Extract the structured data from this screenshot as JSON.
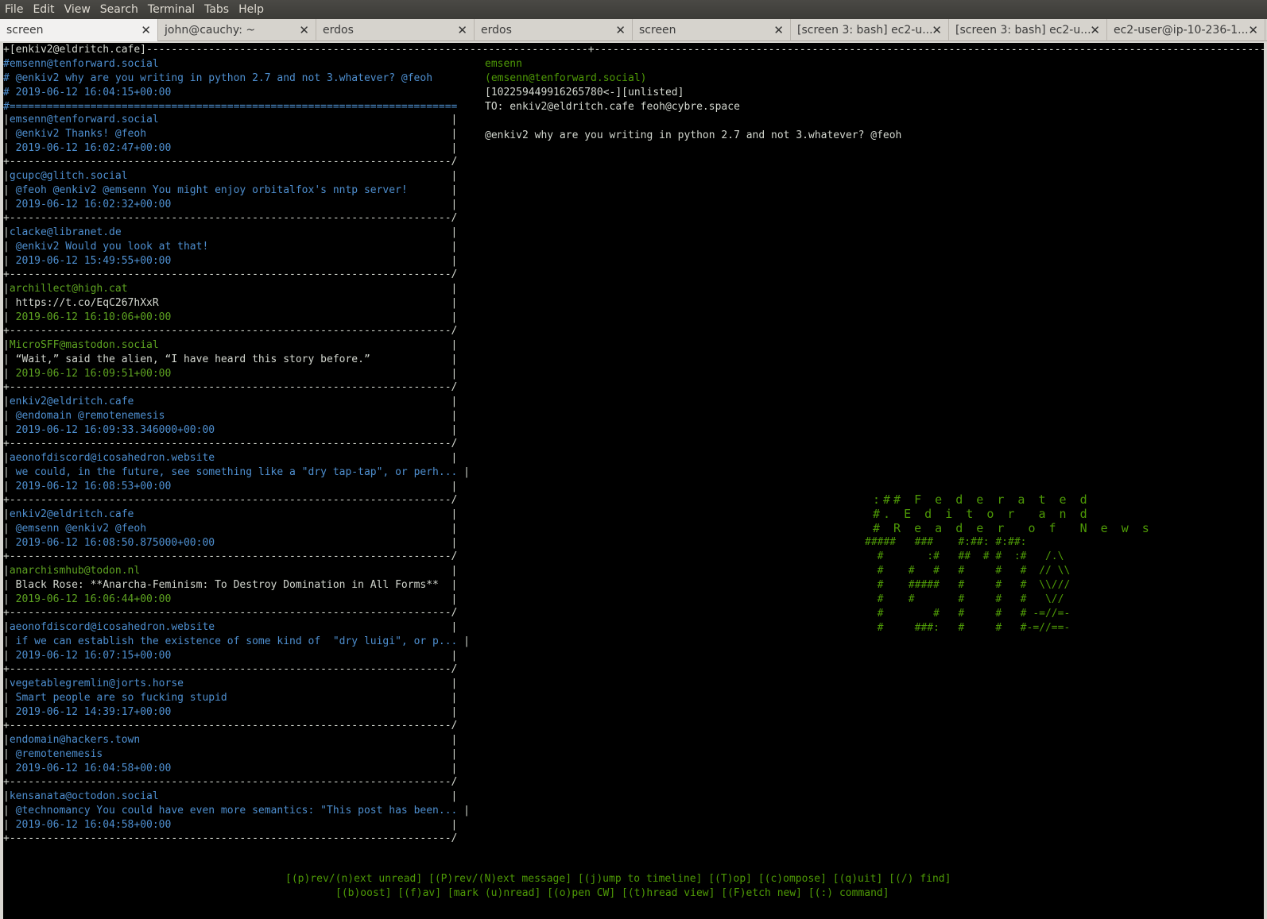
{
  "menubar": [
    "File",
    "Edit",
    "View",
    "Search",
    "Terminal",
    "Tabs",
    "Help"
  ],
  "tabs": [
    {
      "label": "screen",
      "active": true
    },
    {
      "label": "john@cauchy: ~",
      "active": false
    },
    {
      "label": "erdos",
      "active": false
    },
    {
      "label": "erdos",
      "active": false
    },
    {
      "label": "screen",
      "active": false
    },
    {
      "label": "[screen 3: bash] ec2-u...",
      "active": false
    },
    {
      "label": "[screen 3: bash] ec2-u...",
      "active": false
    },
    {
      "label": "ec2-user@ip-10-236-1...",
      "active": false
    }
  ],
  "close_glyph": "✕",
  "top_border": "+[enkiv2@eldritch.cafe]-----------------------------------------------------------------------+--------------------------------------------------------------------------------------------------------------------------",
  "selected": {
    "author": "#emsenn@tenforward.social",
    "body": "# @enkiv2 why are you writing in python 2.7 and not 3.whatever? @feoh",
    "date": "# 2019-06-12 16:04:15+00:00",
    "divider": "#========================================================================"
  },
  "posts": [
    {
      "author": "emsenn@tenforward.social",
      "body": "@enkiv2 Thanks! @feoh",
      "date": "2019-06-12 16:02:47+00:00",
      "author_color": "c",
      "body_color": "c",
      "date_color": "c"
    },
    {
      "author": "gcupc@glitch.social",
      "body": "@feoh @enkiv2 @emsenn You might enjoy orbitalfox's nntp server!",
      "date": "2019-06-12 16:02:32+00:00",
      "author_color": "c",
      "body_color": "c",
      "date_color": "c"
    },
    {
      "author": "clacke@libranet.de",
      "body": "@enkiv2 Would you look at that!",
      "date": "2019-06-12 15:49:55+00:00",
      "author_color": "c",
      "body_color": "c",
      "date_color": "c"
    },
    {
      "author": "archillect@high.cat",
      "body": "https://t.co/EqC267hXxR",
      "date": "2019-06-12 16:10:06+00:00",
      "author_color": "g",
      "body_color": "w",
      "date_color": "g"
    },
    {
      "author": "MicroSFF@mastodon.social",
      "body": "“Wait,” said the alien, “I have heard this story before.”",
      "date": "2019-06-12 16:09:51+00:00",
      "author_color": "g",
      "body_color": "w",
      "date_color": "g"
    },
    {
      "author": "enkiv2@eldritch.cafe",
      "body": "@endomain @remotenemesis",
      "date": "2019-06-12 16:09:33.346000+00:00",
      "author_color": "c",
      "body_color": "c",
      "date_color": "c"
    },
    {
      "author": "aeonofdiscord@icosahedron.website",
      "body": "we could, in the future, see something like a \"dry tap-tap\", or perh...",
      "date": "2019-06-12 16:08:53+00:00",
      "author_color": "c",
      "body_color": "c",
      "date_color": "c"
    },
    {
      "author": "enkiv2@eldritch.cafe",
      "body": "@emsenn @enkiv2 @feoh",
      "date": "2019-06-12 16:08:50.875000+00:00",
      "author_color": "c",
      "body_color": "c",
      "date_color": "c"
    },
    {
      "author": "anarchismhub@todon.nl",
      "body": "Black Rose: **Anarcha-Feminism: To Destroy Domination in All Forms**",
      "date": "2019-06-12 16:06:44+00:00",
      "author_color": "g",
      "body_color": "w",
      "date_color": "g"
    },
    {
      "author": "aeonofdiscord@icosahedron.website",
      "body": "if we can establish the existence of some kind of  \"dry luigi\", or p...",
      "date": "2019-06-12 16:07:15+00:00",
      "author_color": "c",
      "body_color": "c",
      "date_color": "c"
    },
    {
      "author": "vegetablegremlin@jorts.horse",
      "body": "Smart people are so fucking stupid",
      "date": "2019-06-12 14:39:17+00:00",
      "author_color": "c",
      "body_color": "c",
      "date_color": "c"
    },
    {
      "author": "endomain@hackers.town",
      "body": "@remotenemesis",
      "date": "2019-06-12 16:04:58+00:00",
      "author_color": "c",
      "body_color": "c",
      "date_color": "c"
    },
    {
      "author": "kensanata@octodon.social",
      "body": "@technomancy You could have even more semantics: \"This post has been...",
      "date": "2019-06-12 16:04:58+00:00",
      "author_color": "c",
      "body_color": "c",
      "date_color": "c"
    }
  ],
  "detail": {
    "name": "emsenn",
    "handle": "(emsenn@tenforward.social)",
    "id_line": "[102259449916265780<-][unlisted]",
    "to_line": "TO: enkiv2@eldritch.cafe feoh@cybre.space",
    "body": "@enkiv2 why are you writing in python 2.7 and not 3.whatever? @feoh"
  },
  "banner": [
    ":## F e d e r a t e d",
    "#. E d i t o r  a n d",
    "# R e a d e r  o f  N e w s"
  ],
  "ascii_art": "#####   ###    #:##: #:##:\n  #       :#   ##  # #  :#   /.\\\n  #    #   #   #     #   #  // \\\\\n  #    #####   #     #   #  \\\\///\n  #    #       #     #   #   \\//\n  #        #   #     #   # -=//=-\n  #     ###:   #     #   #-=//==-",
  "help": [
    "[(p)rev/(n)ext unread] [(P)rev/(N)ext message] [(j)ump to timeline] [(T)op] [(c)ompose] [(q)uit] [(/) find]",
    "[(b)oost] [(f)av] [mark (u)nread] [(o)pen CW] [(t)hread view] [(F)etch new] [(:) command]"
  ]
}
